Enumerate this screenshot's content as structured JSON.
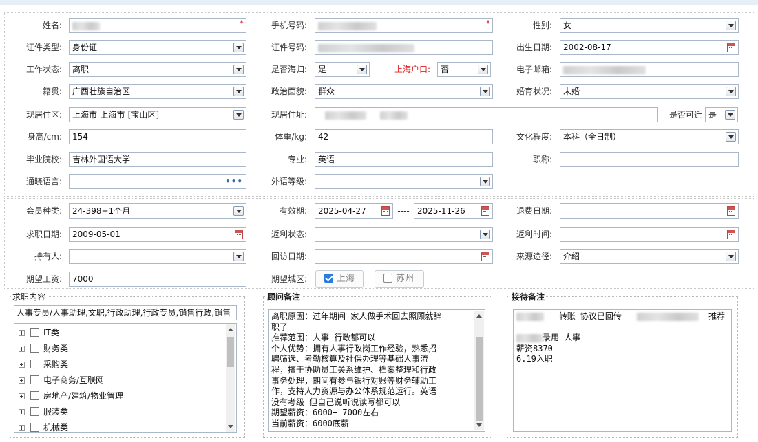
{
  "form": {
    "name_label": "姓名:",
    "phone_label": "手机号码:",
    "gender_label": "性别:",
    "gender_value": "女",
    "idtype_label": "证件类型:",
    "idtype_value": "身份证",
    "idno_label": "证件号码:",
    "birth_label": "出生日期:",
    "birth_value": "2002-08-17",
    "workstatus_label": "工作状态:",
    "workstatus_value": "离职",
    "overseas_label": "是否海归:",
    "overseas_value": "是",
    "shhukou_label": "上海户口:",
    "shhukou_value": "否",
    "email_label": "电子邮箱:",
    "native_label": "籍贯:",
    "native_value": "广西壮族自治区",
    "political_label": "政治面貌:",
    "political_value": "群众",
    "marital_label": "婚育状况:",
    "marital_value": "未婚",
    "curres_label": "现居住区:",
    "curres_value": "上海市-上海市-[宝山区]",
    "curaddr_label": "现居住址:",
    "relocate_label": "是否可迁",
    "relocate_value": "是",
    "height_label": "身高/cm:",
    "height_value": "154",
    "weight_label": "体重/kg:",
    "weight_value": "42",
    "edu_label": "文化程度:",
    "edu_value": "本科（全日制）",
    "school_label": "毕业院校:",
    "school_value": "吉林外国语大学",
    "major_label": "专业:",
    "major_value": "英语",
    "title_label": "职称:",
    "lang_label": "通晓语言:",
    "lang_dots": "•••",
    "foreign_label": "外语等级:",
    "required_mark": "*"
  },
  "member": {
    "type_label": "会员种类:",
    "type_value": "24-398+1个月",
    "valid_label": "有效期:",
    "valid_from": "2025-04-27",
    "valid_sep": "----",
    "valid_to": "2025-11-26",
    "refund_label": "退费日期:",
    "jobdate_label": "求职日期:",
    "jobdate_value": "2009-05-01",
    "rebate_label": "返利状态:",
    "rebatetime_label": "返利时间:",
    "holder_label": "持有人:",
    "visit_label": "回访日期:",
    "source_label": "来源途径:",
    "source_value": "介绍",
    "salary_label": "期望工资:",
    "salary_value": "7000",
    "city_label": "期望城区:",
    "city_sh": "上海",
    "city_sz": "苏州"
  },
  "panels": {
    "job_title": "求职内容",
    "job_summary": "人事专员/人事助理,文职,行政助理,行政专员,销售行政,销售",
    "tree": [
      "IT类",
      "财务类",
      "采购类",
      "电子商务/互联网",
      "房地产/建筑/物业管理",
      "服装类",
      "机械类"
    ],
    "advisor_title": "顾问备注",
    "advisor_lines": [
      "离职原因：过年期间 家人做手术回去照顾就辞",
      "职了",
      "推荐范围：人事 行政都可以",
      "个人优势：拥有人事行政岗工作经验，熟悉招",
      "聘筛选、考勤核算及社保办理等基础人事流",
      "程，擅于协助员工关系维护、档案整理和行政",
      "事务处理，期间有参与银行对账等财务辅助工",
      "作，支持人力资源与办公体系规范运行。英语",
      "没有考级 但自己说听说读写都可以",
      "期望薪资：6000+ 7000左右",
      "当前薪资：6000底薪"
    ],
    "reception_title": "接待备注",
    "reception_l1": "转账 协议已回传",
    "reception_l1b": "推荐",
    "reception_l2": "录用  人事",
    "reception_l3": "薪资8370",
    "reception_l4": "6.19入职"
  }
}
